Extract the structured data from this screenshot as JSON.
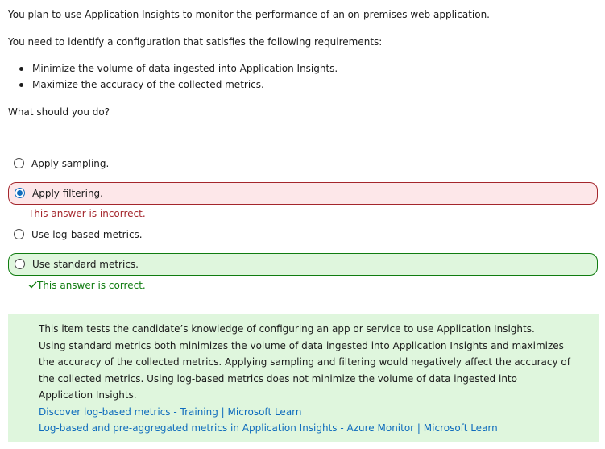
{
  "question": {
    "intro": "You plan to use Application Insights to monitor the performance of an on-premises web application.",
    "need": "You need to identify a configuration that satisfies the following requirements:",
    "requirements": [
      "Minimize the volume of data ingested into Application Insights.",
      "Maximize the accuracy of the collected metrics."
    ],
    "prompt": "What should you do?"
  },
  "options": [
    {
      "label": "Apply sampling.",
      "selected": false
    },
    {
      "label": "Apply filtering.",
      "selected": true,
      "status": "incorrect",
      "feedback": "This answer is incorrect."
    },
    {
      "label": "Use log-based metrics.",
      "selected": false
    },
    {
      "label": "Use standard metrics.",
      "selected": false,
      "status": "correct",
      "feedback": "This answer is correct.",
      "feedback_icon": "check-icon"
    }
  ],
  "explanation": {
    "line1": "This item tests the candidate’s knowledge of configuring an app or service to use Application Insights.",
    "body": "Using standard metrics both minimizes the volume of data ingested into Application Insights and maximizes the accuracy of the collected metrics. Applying sampling and filtering would negatively affect the accuracy of the collected metrics. Using log-based metrics does not minimize the volume of data ingested into Application Insights.",
    "links": [
      "Discover log-based metrics - Training | Microsoft Learn",
      "Log-based and pre-aggregated metrics in Application Insights - Azure Monitor | Microsoft Learn"
    ]
  },
  "colors": {
    "incorrect_bg": "#fde7e9",
    "incorrect_border": "#a4262c",
    "correct_bg": "#dff6dd",
    "correct_border": "#107c10",
    "link": "#0f6cbd",
    "radio_selected": "#0f6cbd"
  }
}
